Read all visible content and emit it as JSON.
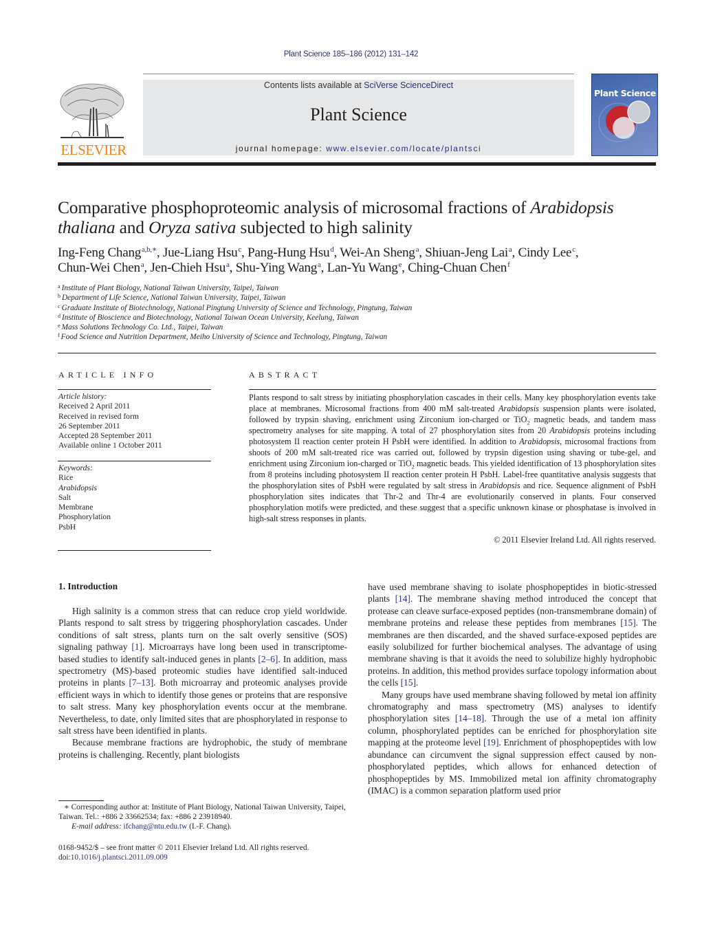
{
  "header": {
    "citation": "Plant Science 185–186 (2012) 131–142",
    "contents_prefix": "Contents lists available at ",
    "contents_link": "SciVerse ScienceDirect",
    "journal_name": "Plant Science",
    "homepage_prefix": "journal homepage: ",
    "homepage_link": "www.elsevier.com/locate/plantsci",
    "publisher_logo_text": "ELSEVIER",
    "cover_title": "Plant Science",
    "colors": {
      "link": "#2b2e83",
      "publisher_orange": "#f07f1a",
      "band": "#e6e7e8",
      "cover_blue": "#3c62a8"
    }
  },
  "article": {
    "title_part1": "Comparative phosphoproteomic analysis of microsomal fractions of ",
    "title_italic1": "Arabidopsis thaliana",
    "title_part2": " and ",
    "title_italic2": "Oryza sativa",
    "title_part3": " subjected to high salinity",
    "authors": [
      {
        "name": "Ing-Feng Chang",
        "aff": "a,b,∗"
      },
      {
        "name": "Jue-Liang Hsu",
        "aff": "c"
      },
      {
        "name": "Pang-Hung Hsu",
        "aff": "d"
      },
      {
        "name": "Wei-An Sheng",
        "aff": "a"
      },
      {
        "name": "Shiuan-Jeng Lai",
        "aff": "a"
      },
      {
        "name": "Cindy Lee",
        "aff": "c"
      },
      {
        "name": "Chun-Wei Chen",
        "aff": "a"
      },
      {
        "name": "Jen-Chieh Hsu",
        "aff": "a"
      },
      {
        "name": "Shu-Ying Wang",
        "aff": "a"
      },
      {
        "name": "Lan-Yu Wang",
        "aff": "e"
      },
      {
        "name": "Ching-Chuan Chen",
        "aff": "f"
      }
    ],
    "affiliations": [
      {
        "key": "a",
        "text": "Institute of Plant Biology, National Taiwan University, Taipei, Taiwan"
      },
      {
        "key": "b",
        "text": "Department of Life Science, National Taiwan University, Taipei, Taiwan"
      },
      {
        "key": "c",
        "text": "Graduate Institute of Biotechnology, National Pingtung University of Science and Technology, Pingtung, Taiwan"
      },
      {
        "key": "d",
        "text": "Institute of Bioscience and Biotechnology, National Taiwan Ocean University, Keelung, Taiwan"
      },
      {
        "key": "e",
        "text": "Mass Solutions Technology Co. Ltd., Taipei, Taiwan"
      },
      {
        "key": "f",
        "text": "Food Science and Nutrition Department, Meiho University of Science and Technology, Pingtung, Taiwan"
      }
    ]
  },
  "article_info": {
    "heading": "ARTICLE INFO",
    "history_label": "Article history:",
    "history": [
      "Received 2 April 2011",
      "Received in revised form",
      "26 September 2011",
      "Accepted 28 September 2011",
      "Available online 1 October 2011"
    ],
    "keywords_label": "Keywords:",
    "keywords": [
      "Rice",
      "Arabidopsis",
      "Salt",
      "Membrane",
      "Phosphorylation",
      "PsbH"
    ]
  },
  "abstract": {
    "heading": "ABSTRACT",
    "segments": [
      {
        "t": "Plants respond to salt stress by initiating phosphorylation cascades in their cells. Many key phosphorylation events take place at membranes. Microsomal fractions from 400 mM salt-treated "
      },
      {
        "t": "Arabidopsis",
        "i": true
      },
      {
        "t": " suspension plants were isolated, followed by trypsin shaving, enrichment using Zirconium ion-charged or TiO"
      },
      {
        "t": "2",
        "sub": true
      },
      {
        "t": " magnetic beads, and tandem mass spectrometry analyses for site mapping. A total of 27 phosphorylation sites from 20 "
      },
      {
        "t": "Arabidopsis",
        "i": true
      },
      {
        "t": " proteins including photosystem II reaction center protein H PsbH were identified. In addition to "
      },
      {
        "t": "Arabidopsis",
        "i": true
      },
      {
        "t": ", microsomal fractions from shoots of 200 mM salt-treated rice was carried out, followed by trypsin digestion using shaving or tube-gel, and enrichment using Zirconium ion-charged or TiO"
      },
      {
        "t": "2",
        "sub": true
      },
      {
        "t": " magnetic beads. This yielded identification of 13 phosphorylation sites from 8 proteins including photosystem II reaction center protein H PsbH. Label-free quantitative analysis suggests that the phosphorylation sites of PsbH were regulated by salt stress in "
      },
      {
        "t": "Arabidopsis",
        "i": true
      },
      {
        "t": " and rice. Sequence alignment of PsbH phosphorylation sites indicates that Thr-2 and Thr-4 are evolutionarily conserved in plants. Four conserved phosphorylation motifs were predicted, and these suggest that a specific unknown kinase or phosphatase is involved in high-salt stress responses in plants."
      }
    ],
    "copyright": "© 2011 Elsevier Ireland Ltd. All rights reserved."
  },
  "body": {
    "section_heading": "1.  Introduction",
    "left_paragraphs": [
      [
        {
          "t": "High salinity is a common stress that can reduce crop yield worldwide. Plants respond to salt stress by triggering phosphorylation cascades. Under conditions of salt stress, plants turn on the salt overly sensitive (SOS) signaling pathway "
        },
        {
          "t": "[1]",
          "ref": true
        },
        {
          "t": ". Microarrays have long been used in transcriptome-based studies to identify salt-induced genes in plants "
        },
        {
          "t": "[2–6]",
          "ref": true
        },
        {
          "t": ". In addition, mass spectrometry (MS)-based proteomic studies have identified salt-induced proteins in plants "
        },
        {
          "t": "[7–13]",
          "ref": true
        },
        {
          "t": ". Both microarray and proteomic analyses provide efficient ways in which to identify those genes or proteins that are responsive to salt stress. Many key phosphorylation events occur at the membrane. Nevertheless, to date, only limited sites that are phosphorylated in response to salt stress have been identified in plants."
        }
      ],
      [
        {
          "t": "Because membrane fractions are hydrophobic, the study of membrane proteins is challenging. Recently, plant biologists"
        }
      ]
    ],
    "right_paragraphs": [
      [
        {
          "t": "have used membrane shaving to isolate phosphopeptides in biotic-stressed plants "
        },
        {
          "t": "[14]",
          "ref": true
        },
        {
          "t": ". The membrane shaving method introduced the concept that protease can cleave surface-exposed peptides (non-transmembrane domain) of membrane proteins and release these peptides from membranes "
        },
        {
          "t": "[15]",
          "ref": true
        },
        {
          "t": ". The membranes are then discarded, and the shaved surface-exposed peptides are easily solubilized for further biochemical analyses. The advantage of using membrane shaving is that it avoids the need to solubilize highly hydrophobic proteins. In addition, this method provides surface topology information about the cells "
        },
        {
          "t": "[15]",
          "ref": true
        },
        {
          "t": "."
        }
      ],
      [
        {
          "t": "Many groups have used membrane shaving followed by metal ion affinity chromatography and mass spectrometry (MS) analyses to identify phosphorylation sites "
        },
        {
          "t": "[14–18]",
          "ref": true
        },
        {
          "t": ". Through the use of a metal ion affinity column, phosphorylated peptides can be enriched for phosphorylation site mapping at the proteome level "
        },
        {
          "t": "[19]",
          "ref": true
        },
        {
          "t": ". Enrichment of phosphopeptides with low abundance can circumvent the signal suppression effect caused by non-phosphorylated peptides, which allows for enhanced detection of phosphopeptides by MS. Immobilized metal ion affinity chromatography (IMAC) is a common separation platform used prior"
        }
      ]
    ]
  },
  "footnotes": {
    "corresponding": "∗  Corresponding author at: Institute of Plant Biology, National Taiwan University, Taipei, Taiwan. Tel.: +886 2 33662534; fax: +886 2 23918940.",
    "email_label": "E-mail address: ",
    "email": "ifchang@ntu.edu.tw",
    "email_suffix": " (I.-F. Chang).",
    "issn_line": "0168-9452/$ – see front matter © 2011 Elsevier Ireland Ltd. All rights reserved.",
    "doi_prefix": "doi:",
    "doi": "10.1016/j.plantsci.2011.09.009"
  }
}
